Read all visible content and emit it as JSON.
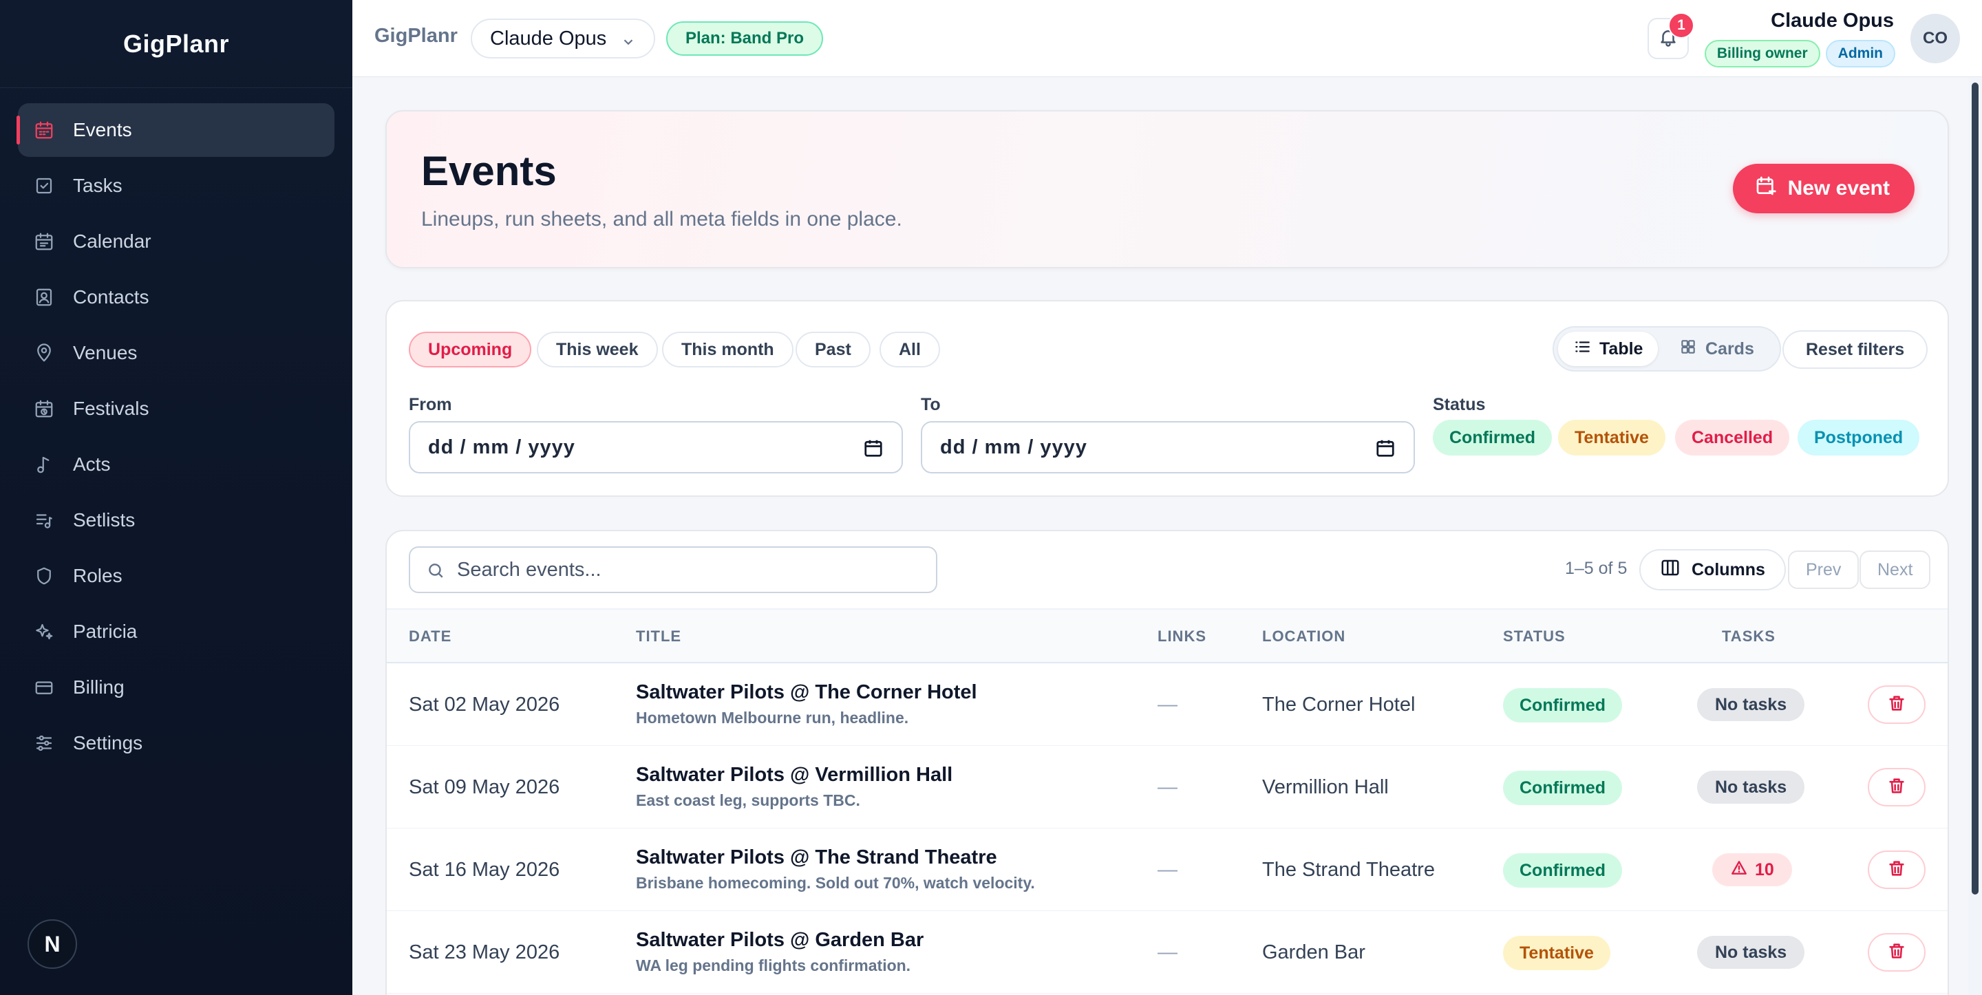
{
  "sidebar": {
    "brand": "GigPlanr",
    "items": [
      {
        "label": "Events",
        "icon": "calendar-icon",
        "active": true
      },
      {
        "label": "Tasks",
        "icon": "checkbox-icon"
      },
      {
        "label": "Calendar",
        "icon": "calendar-grid-icon"
      },
      {
        "label": "Contacts",
        "icon": "contact-card-icon"
      },
      {
        "label": "Venues",
        "icon": "map-pin-icon"
      },
      {
        "label": "Festivals",
        "icon": "festival-calendar-icon"
      },
      {
        "label": "Acts",
        "icon": "music-note-icon"
      },
      {
        "label": "Setlists",
        "icon": "setlist-icon"
      },
      {
        "label": "Roles",
        "icon": "shield-icon"
      },
      {
        "label": "Patricia",
        "icon": "sparkles-icon"
      },
      {
        "label": "Billing",
        "icon": "credit-card-icon"
      },
      {
        "label": "Settings",
        "icon": "sliders-icon"
      }
    ],
    "footer_logo": "N"
  },
  "topbar": {
    "brand": "GigPlanr",
    "account": "Claude Opus",
    "plan": "Plan: Band Pro",
    "notifications": "1",
    "user_name": "Claude Opus",
    "roles": [
      "Billing owner",
      "Admin"
    ],
    "avatar_initials": "CO"
  },
  "hero": {
    "title": "Events",
    "subtitle": "Lineups, run sheets, and all meta fields in one place.",
    "new_event_label": "New event"
  },
  "filters": {
    "ranges": [
      "Upcoming",
      "This week",
      "This month",
      "Past",
      "All"
    ],
    "active_range": "Upcoming",
    "view_table": "Table",
    "view_cards": "Cards",
    "reset": "Reset filters",
    "from_label": "From",
    "to_label": "To",
    "date_placeholder": "dd / mm / yyyy",
    "status_label": "Status",
    "statuses": [
      "Confirmed",
      "Tentative",
      "Cancelled",
      "Postponed"
    ]
  },
  "table": {
    "search_placeholder": "Search events...",
    "pager": "1–5 of 5",
    "columns_label": "Columns",
    "prev": "Prev",
    "next": "Next",
    "headers": [
      "DATE",
      "TITLE",
      "LINKS",
      "LOCATION",
      "STATUS",
      "TASKS"
    ],
    "rows": [
      {
        "date": "Sat 02 May 2026",
        "title": "Saltwater Pilots @ The Corner Hotel",
        "subtitle": "Hometown Melbourne run, headline.",
        "links": "—",
        "location": "The Corner Hotel",
        "status": "Confirmed",
        "tasks": "No tasks"
      },
      {
        "date": "Sat 09 May 2026",
        "title": "Saltwater Pilots @ Vermillion Hall",
        "subtitle": "East coast leg, supports TBC.",
        "links": "—",
        "location": "Vermillion Hall",
        "status": "Confirmed",
        "tasks": "No tasks"
      },
      {
        "date": "Sat 16 May 2026",
        "title": "Saltwater Pilots @ The Strand Theatre",
        "subtitle": "Brisbane homecoming. Sold out 70%, watch velocity.",
        "links": "—",
        "location": "The Strand Theatre",
        "status": "Confirmed",
        "tasks": "10"
      },
      {
        "date": "Sat 23 May 2026",
        "title": "Saltwater Pilots @ Garden Bar",
        "subtitle": "WA leg pending flights confirmation.",
        "links": "—",
        "location": "Garden Bar",
        "status": "Tentative",
        "tasks": "No tasks"
      }
    ]
  },
  "colors": {
    "accent": "#f43f5e",
    "sidebar_bg": "#0f1a2e",
    "confirmed": "#047857",
    "tentative": "#b45309",
    "cancelled": "#e11d48",
    "postponed": "#0891b2"
  }
}
